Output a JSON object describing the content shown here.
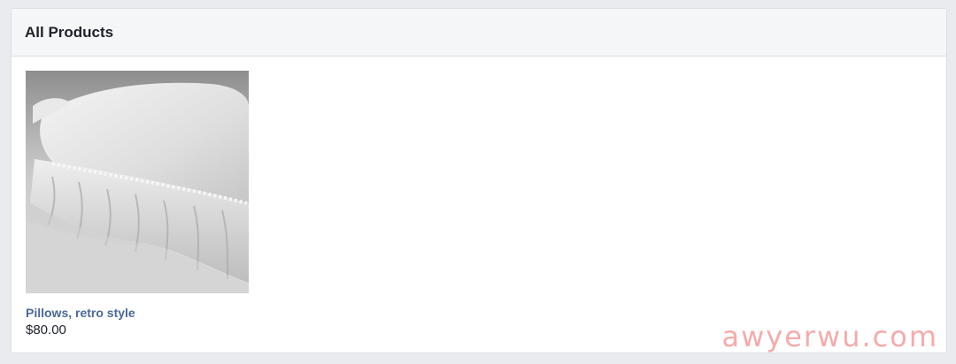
{
  "panel": {
    "title": "All Products"
  },
  "products": [
    {
      "name": "Pillows, retro style",
      "price": "$80.00",
      "image": "white-ruffled-pillow-photo"
    }
  ],
  "watermark": "awyerwu.com",
  "colors": {
    "page_background": "#e9ebee",
    "header_background": "#f5f6f7",
    "link": "#4b6a98",
    "text": "#1d2129",
    "watermark": "#f48e8e"
  }
}
